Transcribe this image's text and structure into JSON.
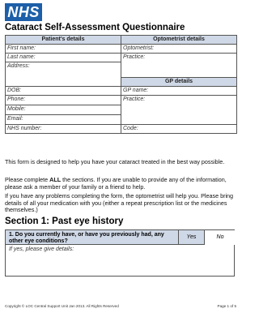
{
  "header": {
    "logo_text": "NHS",
    "title": "Cataract Self-Assessment Questionnaire",
    "brand_color": "#1d5fa8",
    "header_fill": "#cfd8e6"
  },
  "form": {
    "patient_header": "Patient's details",
    "optometrist_header": "Optometrist details",
    "gp_header": "GP details",
    "first_name": "First name:",
    "last_name": "Last name:",
    "address": "Address:",
    "optometrist": "Optometrist:",
    "practice": "Practice:",
    "dob": "DOB:",
    "phone": "Phone:",
    "mobile": "Mobile:",
    "email": "Email:",
    "nhs_number": "NHS number:",
    "gp_name": "GP name:",
    "gp_practice": "Practice:",
    "code": "Code:"
  },
  "intro": {
    "p1": "This form is designed to help you have your cataract treated in the best way possible.",
    "p2_before": "Please complete ",
    "p2_bold": "ALL",
    "p2_after": " the sections. If you are unable to provide any of the information, please ask a member of your family or a friend to help.",
    "p3": "If you have any problems completing the form, the optometrist will help you. Please bring details of all your medication with you (either a repeat prescription list or the medicines themselves.)"
  },
  "section1": {
    "title": "Section 1: Past eye history",
    "q1": "1.  Do you currently have, or have you previously had, any other eye conditions?",
    "yes": "Yes",
    "no": "No",
    "details": "If yes, please give details:"
  },
  "footer": {
    "copyright": "Copyright © LOC Central Support Unit Jan 2013. All Rights Reserved",
    "page": "Page 1 of 5"
  }
}
